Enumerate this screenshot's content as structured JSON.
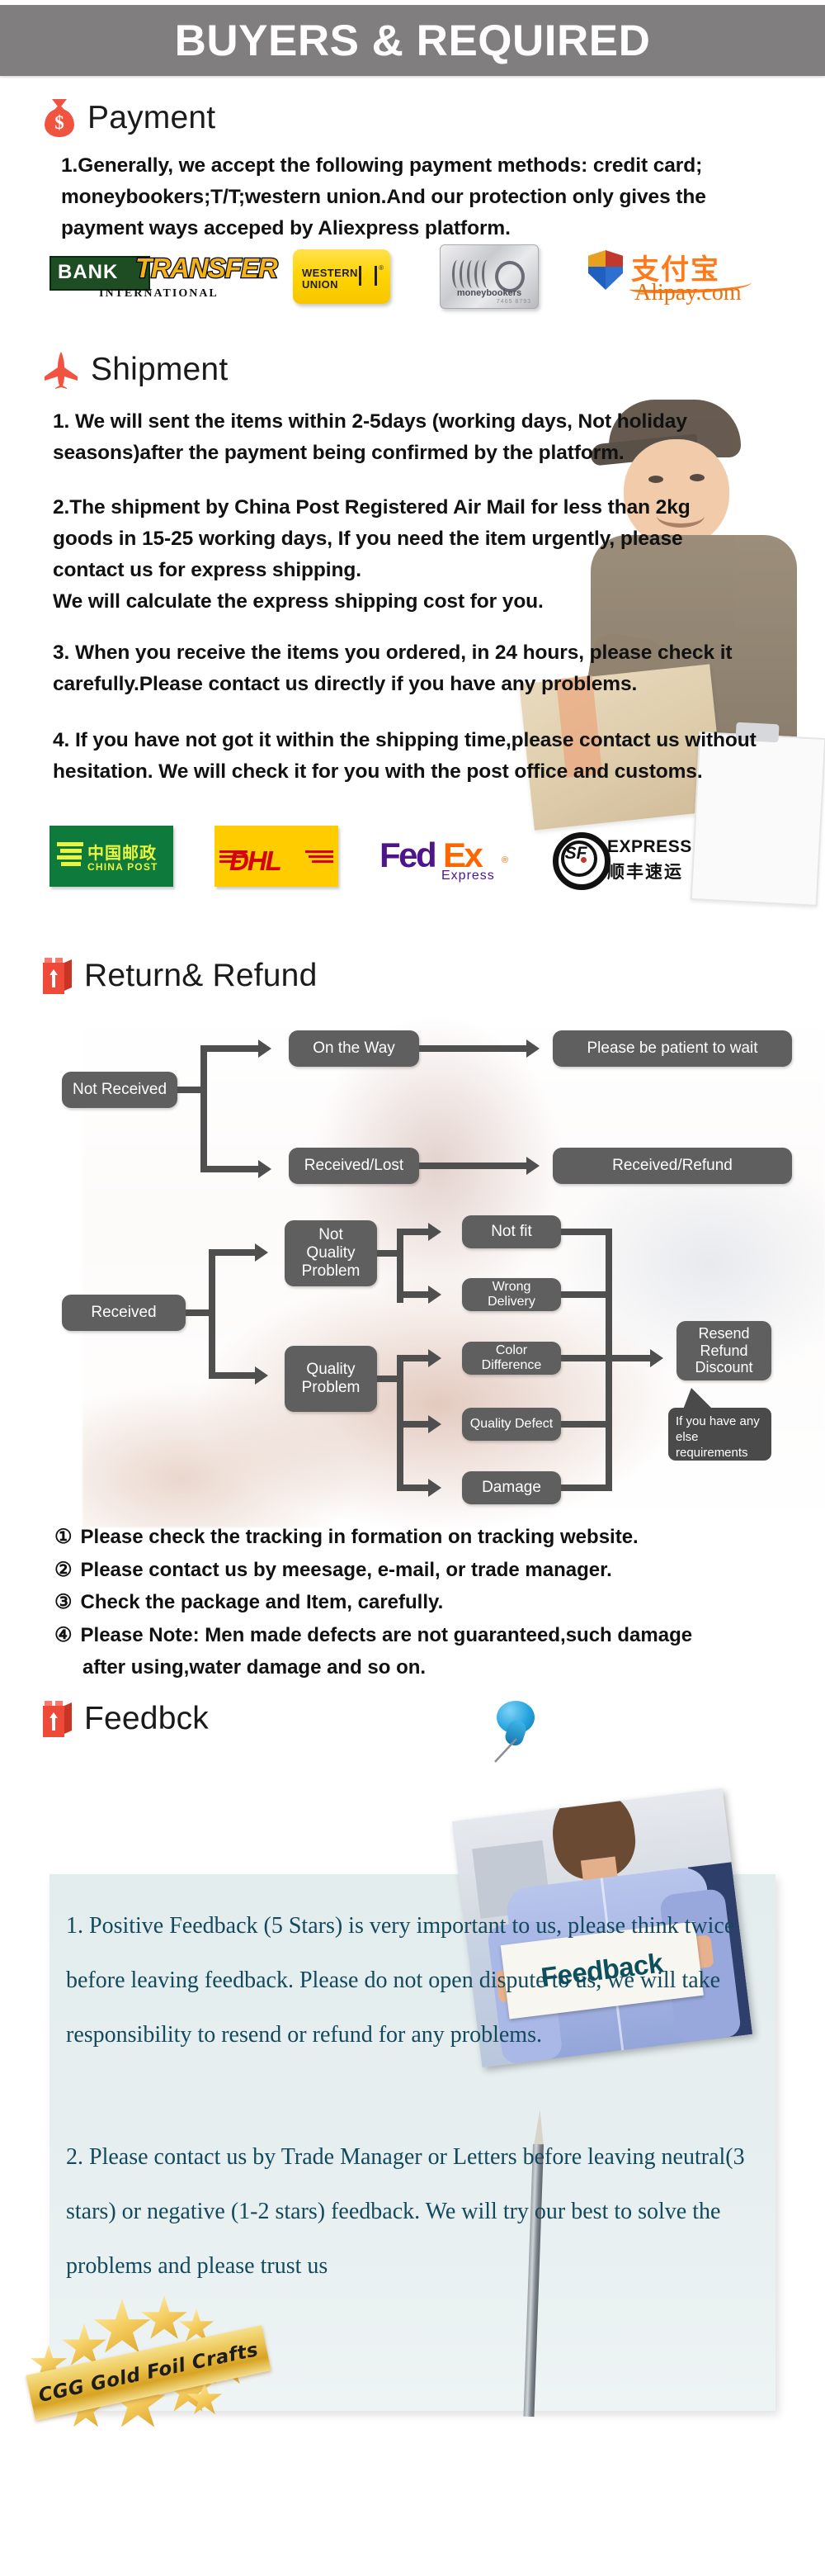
{
  "banner": {
    "title": "BUYERS & REQUIRED"
  },
  "payment": {
    "heading": "Payment",
    "icon": "money-bag-icon",
    "paragraph": "1.Generally, we accept the following payment methods: credit card; moneybookers;T/T;western union.And our protection only gives the payment ways acceped by Aliexpress platform.",
    "logos": [
      {
        "name": "bank-transfer-logo",
        "word1": "BANK",
        "word2": "TRANSFER",
        "sub": "INTERNATIONAL"
      },
      {
        "name": "western-union-logo",
        "line1": "WESTERN",
        "line2": "UNION"
      },
      {
        "name": "moneybookers-logo",
        "label": "moneybookers",
        "number": "7465 8793"
      },
      {
        "name": "alipay-logo",
        "cn": "支付宝",
        "domain": "Alipay.com"
      }
    ]
  },
  "shipment": {
    "heading": "Shipment",
    "icon": "airplane-icon",
    "paragraphs": [
      "1. We will sent the items within 2-5days (working days, Not holiday seasons)after the payment being confirmed by the platform.",
      "2.The shipment by China Post Registered Air Mail for less than  2kg goods in 15-25 working days, If  you need the item urgently, please contact us for express shipping.\nWe will calculate the express shipping cost for you.",
      "3. When you receive the items you ordered, in 24 hours, please check  it carefully.Please contact us directly if you have any problems.",
      "4. If you have not got it within the shipping time,please contact us without hesitation. We will check it for you with the post office and customs."
    ],
    "logos": [
      {
        "name": "china-post-logo",
        "cn": "中国邮政",
        "en": "CHINA POST"
      },
      {
        "name": "dhl-logo",
        "word": "DHL"
      },
      {
        "name": "fedex-logo",
        "fed": "Fed",
        "ex": "Ex",
        "sub": "Express"
      },
      {
        "name": "sf-express-logo",
        "mark": "SF",
        "en": "EXPRESS",
        "cn": "顺丰速运"
      }
    ]
  },
  "returns": {
    "heading": "Return& Refund",
    "icon": "package-box-icon",
    "flowchart": {
      "nodes": {
        "not_received": "Not Received",
        "on_the_way": "On the Way",
        "please_wait": "Please be patient to wait",
        "received_lost": "Received/Lost",
        "received_refund_out": "Received/Refund",
        "received": "Received",
        "not_quality_problem": "Not\nQuality\nProblem",
        "quality_problem": "Quality\nProblem",
        "not_fit": "Not fit",
        "wrong_delivery": "Wrong Delivery",
        "color_difference": "Color Difference",
        "quality_defect": "Quality Defect",
        "damage": "Damage",
        "resend_refund_discount": "Resend\nRefund\nDiscount",
        "bubble": "If you have any else requirements you could also tell us"
      }
    },
    "notes": [
      {
        "num": "①",
        "text": "Please check the tracking in formation on tracking website."
      },
      {
        "num": "②",
        "text": "Please contact us by meesage, e-mail, or trade manager."
      },
      {
        "num": "③",
        "text": "Check the package and Item, carefully."
      },
      {
        "num": "④",
        "text": "Please Note: Men made defects  are not guaranteed,such damage"
      },
      {
        "num": "",
        "text": "after using,water damage and so on."
      }
    ]
  },
  "feedback": {
    "heading": "Feedbck",
    "icon": "package-box-icon",
    "photo_sign_text": "Feedback",
    "paragraphs": [
      "1. Positive Feedback (5 Stars) is very important to us, please think twice before leaving feedback. Please do not open dispute to us,   we will take responsibility to resend or refund for any problems.",
      "2. Please contact us by Trade Manager or Letters before leaving neutral(3 stars) or negative (1-2 stars) feedback. We will try our best to solve the problems and please trust us"
    ]
  },
  "badge": {
    "text": "CGG Gold Foil Crafts"
  },
  "colors": {
    "banner_bg": "#807e7e",
    "accent_red": "#ee4a3a",
    "flow_node": "#5f5f5f",
    "feedback_bg": "#e4edee",
    "feedback_text": "#13495c",
    "gold": "#e9bf4a"
  }
}
